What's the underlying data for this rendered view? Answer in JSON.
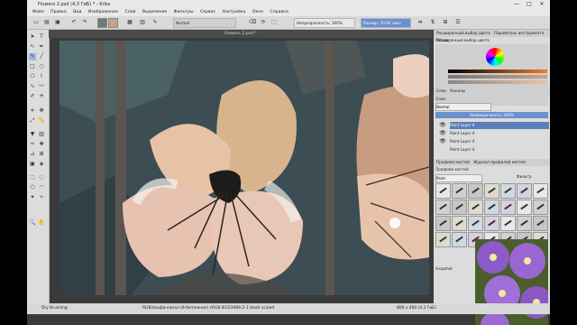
{
  "window": {
    "title": "Flowers 2.psd (4,3 ГиБ) * - Krita",
    "controls": [
      "—",
      "□",
      "✕"
    ]
  },
  "menu": [
    "Файл",
    "Правка",
    "Вид",
    "Изображение",
    "Слой",
    "Выделение",
    "Фильтры",
    "Сервис",
    "Настройка",
    "Окно",
    "Справка"
  ],
  "toolbar": {
    "blend_mode": "Normal",
    "opacity_label": "Непрозрачность: 100%",
    "size_label": "Размер: 70,00 пикс."
  },
  "canvas": {
    "tab_title": "Flowers 2.psd *"
  },
  "dock": {
    "top_tabs": [
      "Расширенный выбор цвета",
      "Параметры инструмента",
      "Обзор"
    ],
    "color_selector_title": "Расширенный выбор цвета",
    "layers_tabs": [
      "Слои",
      "Каналы"
    ],
    "layers_title": "Слои",
    "blend_mode": "Normal",
    "opacity_label": "Непрозрачность: 100%",
    "layers": [
      "Paint Layer 4",
      "Paint Layer 4",
      "Paint Layer 4",
      "Paint Layer 4"
    ],
    "brush_tabs": [
      "Профили кистей",
      "Журнал профилей кистей"
    ],
    "brush_title": "Профили кистей",
    "brush_tag": "Paint",
    "filter_label": "Фильтр",
    "ref_label": "Snapshot"
  },
  "status": {
    "brush": "Dry Brushing",
    "info": "RGB/альфа-канал (8-бит/канал) sRGB IEC61966-2-1 black scaled",
    "dims": "800 x 400 (4,3 ГиБ)"
  },
  "colors": {
    "selection": "#5b7fb8",
    "panel": "#dcdcdc",
    "canvas_bg": "#3e4f55",
    "petal": "#e9c3a5",
    "accent": "#f07c2a"
  }
}
